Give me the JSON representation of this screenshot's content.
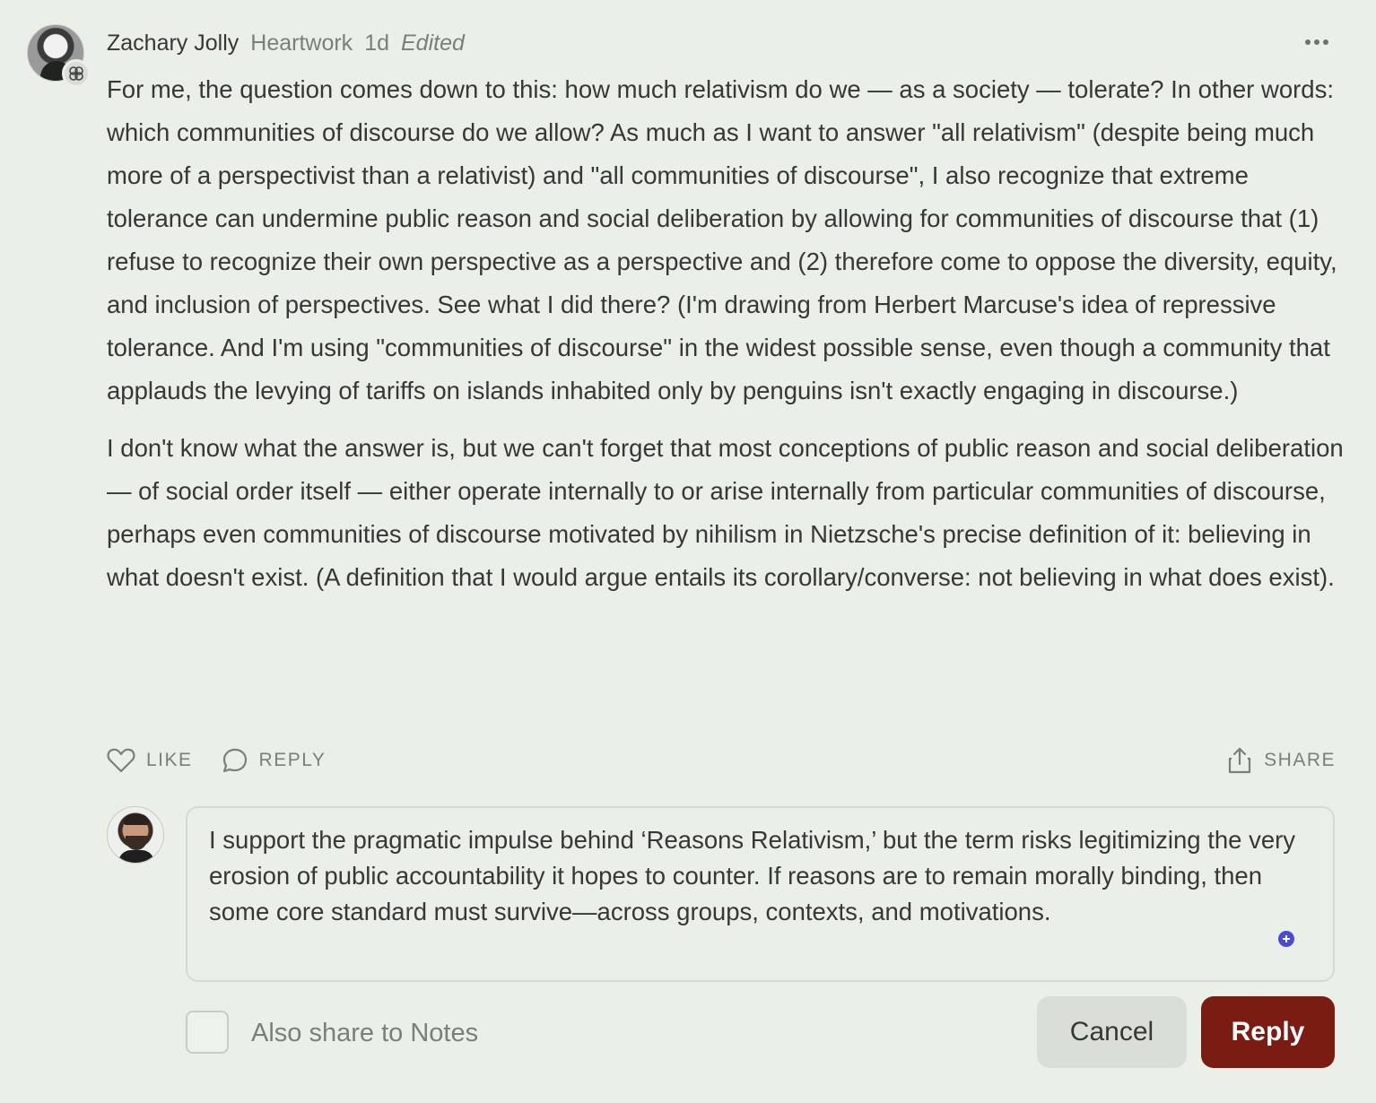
{
  "comment": {
    "author": "Zachary Jolly",
    "publication": "Heartwork",
    "time": "1d",
    "edited_label": "Edited",
    "paragraphs": [
      "For me, the question comes down to this: how much relativism do we — as a society — tolerate? In other words: which communities of discourse do we allow? As much as I want to answer \"all relativism\" (despite being much more of a perspectivist than a relativist) and \"all communities of discourse\", I also recognize that extreme tolerance can undermine public reason and social deliberation by allowing for communities of discourse that (1) refuse to recognize their own perspective as a perspective and (2) therefore come to oppose the diversity, equity, and inclusion of perspectives. See what I did there? (I'm drawing from Herbert Marcuse's idea of repressive tolerance. And I'm using \"communities of discourse\" in the widest possible sense, even though a community that applauds the levying of tariffs on islands inhabited only by penguins isn't exactly engaging in discourse.)",
      "I don't know what the answer is, but we can't forget that most conceptions of public reason and social deliberation — of social order itself — either operate internally to or arise internally from particular communities of discourse, perhaps even communities of discourse motivated by nihilism in Nietzsche's precise definition of it: believing in what doesn't exist. (A definition that I would argue entails its corollary/converse: not believing in what does exist)."
    ],
    "actions": {
      "like": "LIKE",
      "reply": "REPLY",
      "share": "SHARE"
    }
  },
  "reply_form": {
    "text": "I support the pragmatic impulse behind ‘Reasons Relativism,’ but the term risks legitimizing the very erosion of public accountability it hopes to counter. If reasons are to remain morally binding, then some core standard must survive—across groups, contexts, and motivations.",
    "share_label": "Also share to Notes",
    "cancel_label": "Cancel",
    "submit_label": "Reply"
  },
  "colors": {
    "background": "#eaf0e8",
    "accent": "#7a1c12",
    "muted_text": "#7b7f7c"
  }
}
